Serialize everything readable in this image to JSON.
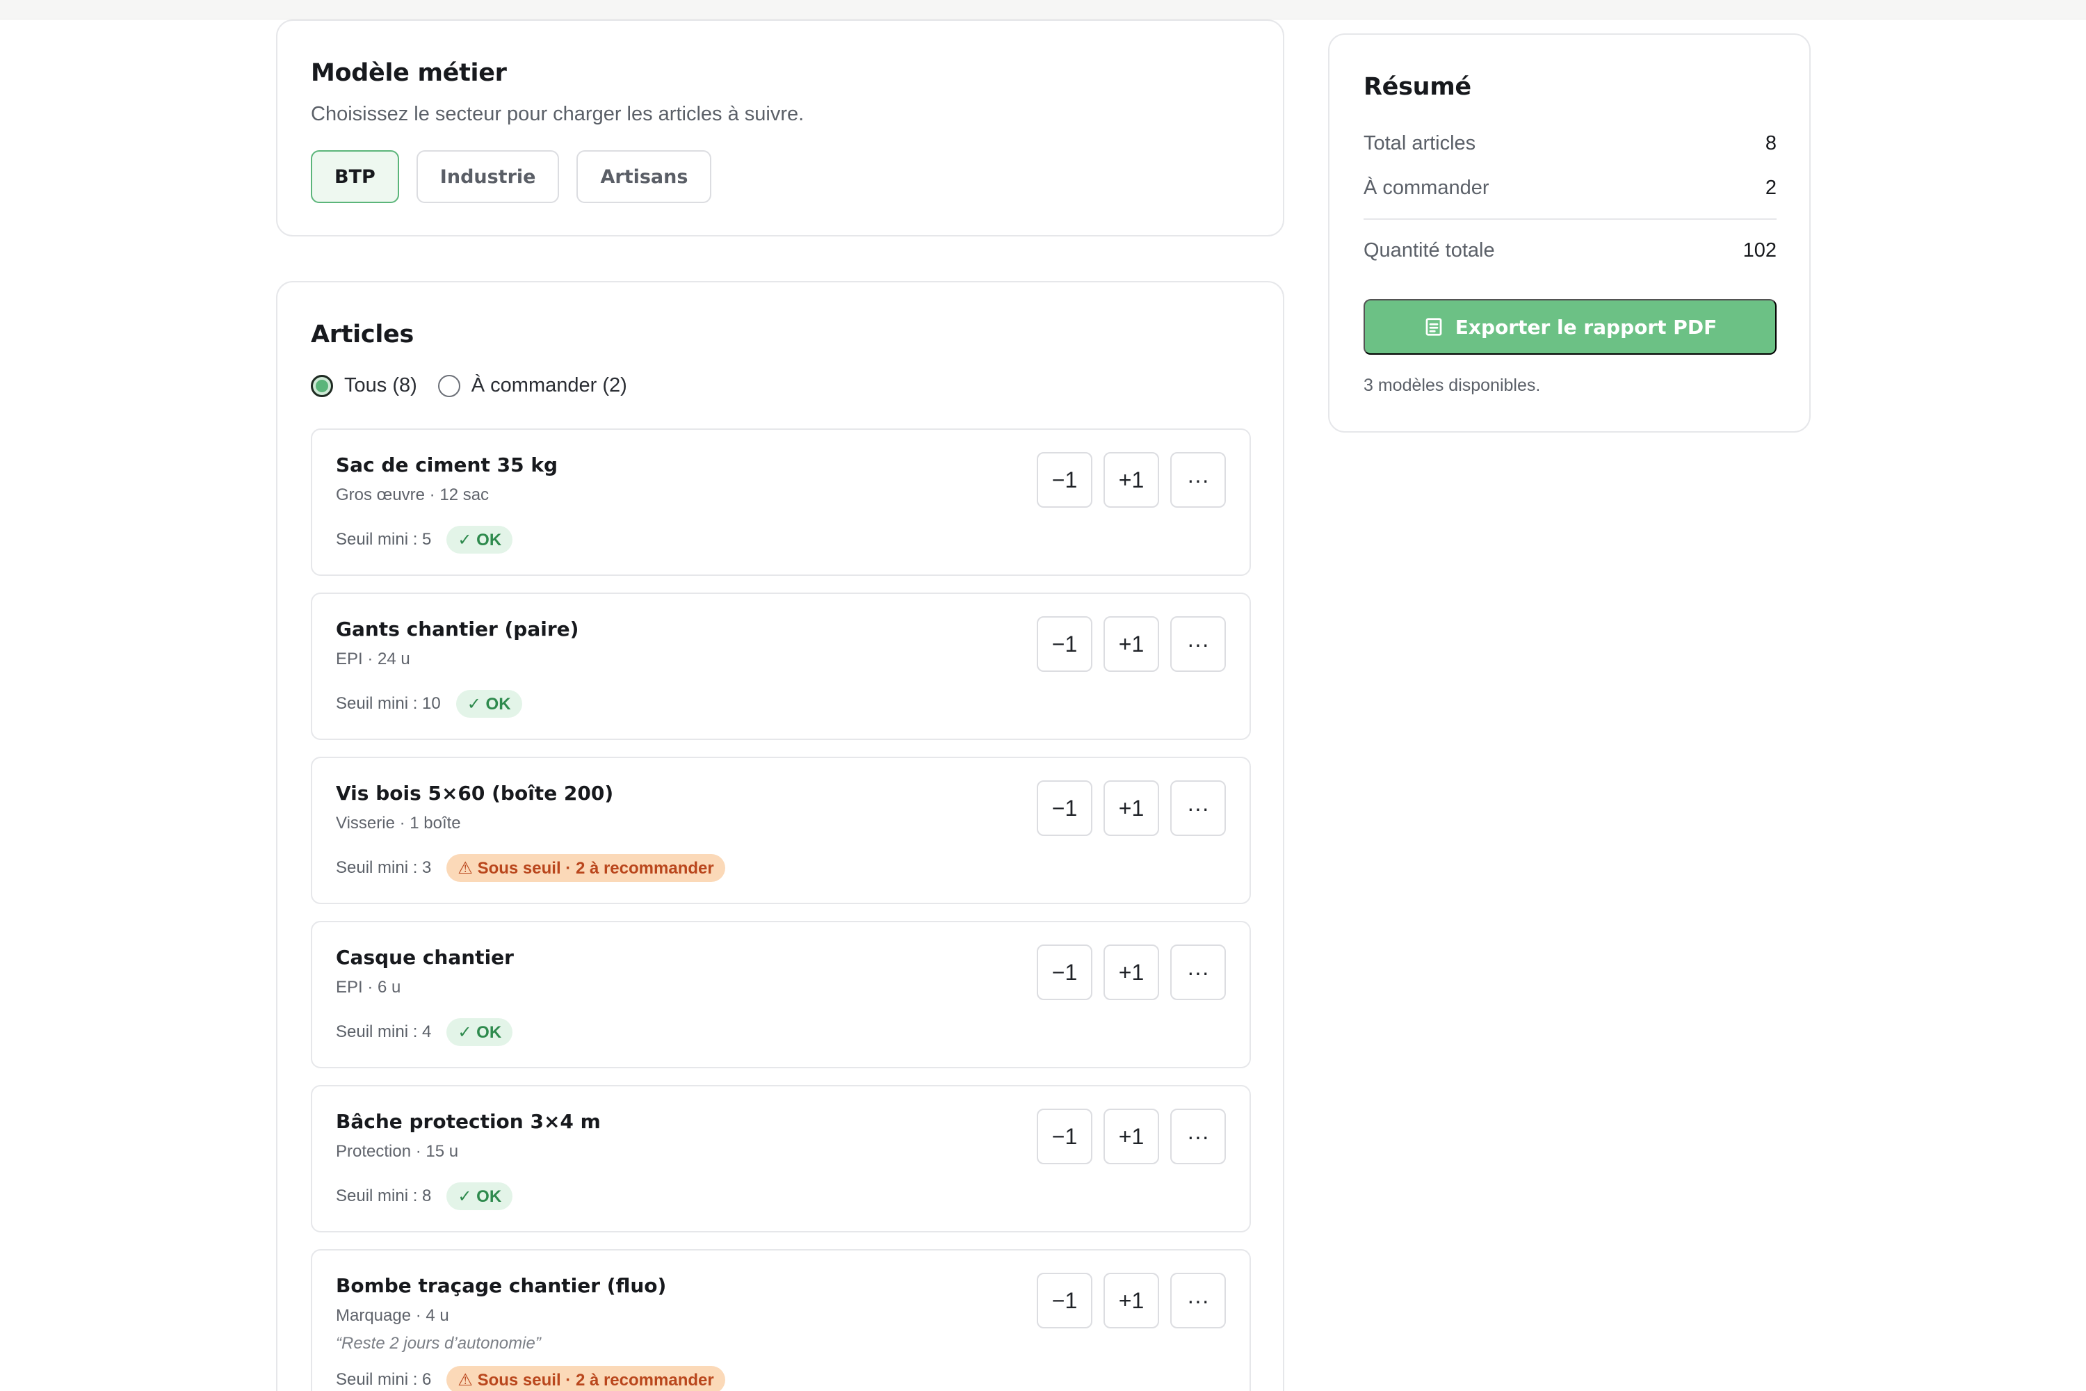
{
  "model": {
    "title": "Modèle métier",
    "description": "Choisissez le secteur pour charger les articles à suivre.",
    "segments": [
      {
        "label": "BTP",
        "active": true
      },
      {
        "label": "Industrie",
        "active": false
      },
      {
        "label": "Artisans",
        "active": false
      }
    ]
  },
  "articles": {
    "title": "Articles",
    "filters": [
      {
        "label": "Tous (8)",
        "checked": true
      },
      {
        "label": "À commander (2)",
        "checked": false
      }
    ],
    "button_labels": {
      "minus": "−1",
      "plus": "+1",
      "more": "···"
    },
    "items": [
      {
        "name": "Sac de ciment 35 kg",
        "meta": "Gros œuvre · 12 sac",
        "note": "",
        "threshold": "Seuil mini : 5",
        "status": "ok",
        "status_label": "✓ OK"
      },
      {
        "name": "Gants chantier (paire)",
        "meta": "EPI · 24 u",
        "note": "",
        "threshold": "Seuil mini : 10",
        "status": "ok",
        "status_label": "✓ OK"
      },
      {
        "name": "Vis bois 5×60 (boîte 200)",
        "meta": "Visserie · 1 boîte",
        "note": "",
        "threshold": "Seuil mini : 3",
        "status": "warn",
        "status_label": "⚠ Sous seuil · 2 à recommander"
      },
      {
        "name": "Casque chantier",
        "meta": "EPI · 6 u",
        "note": "",
        "threshold": "Seuil mini : 4",
        "status": "ok",
        "status_label": "✓ OK"
      },
      {
        "name": "Bâche protection 3×4 m",
        "meta": "Protection · 15 u",
        "note": "",
        "threshold": "Seuil mini : 8",
        "status": "ok",
        "status_label": "✓ OK"
      },
      {
        "name": "Bombe traçage chantier (fluo)",
        "meta": "Marquage · 4 u",
        "note": "“Reste 2 jours d’autonomie”",
        "threshold": "Seuil mini : 6",
        "status": "warn",
        "status_label": "⚠ Sous seuil · 2 à recommander"
      }
    ]
  },
  "summary": {
    "title": "Résumé",
    "rows": [
      {
        "label": "Total articles",
        "value": "8"
      },
      {
        "label": "À commander",
        "value": "2"
      },
      {
        "label": "Quantité totale",
        "value": "102"
      }
    ],
    "export_label": "Exporter le rapport PDF",
    "footer": "3 modèles disponibles."
  },
  "colors": {
    "accent": "#6cc185",
    "ok_bg": "#e3f4e8",
    "ok_text": "#2e8a4d",
    "warn_bg": "#fbd9b8",
    "warn_text": "#b9461c"
  }
}
